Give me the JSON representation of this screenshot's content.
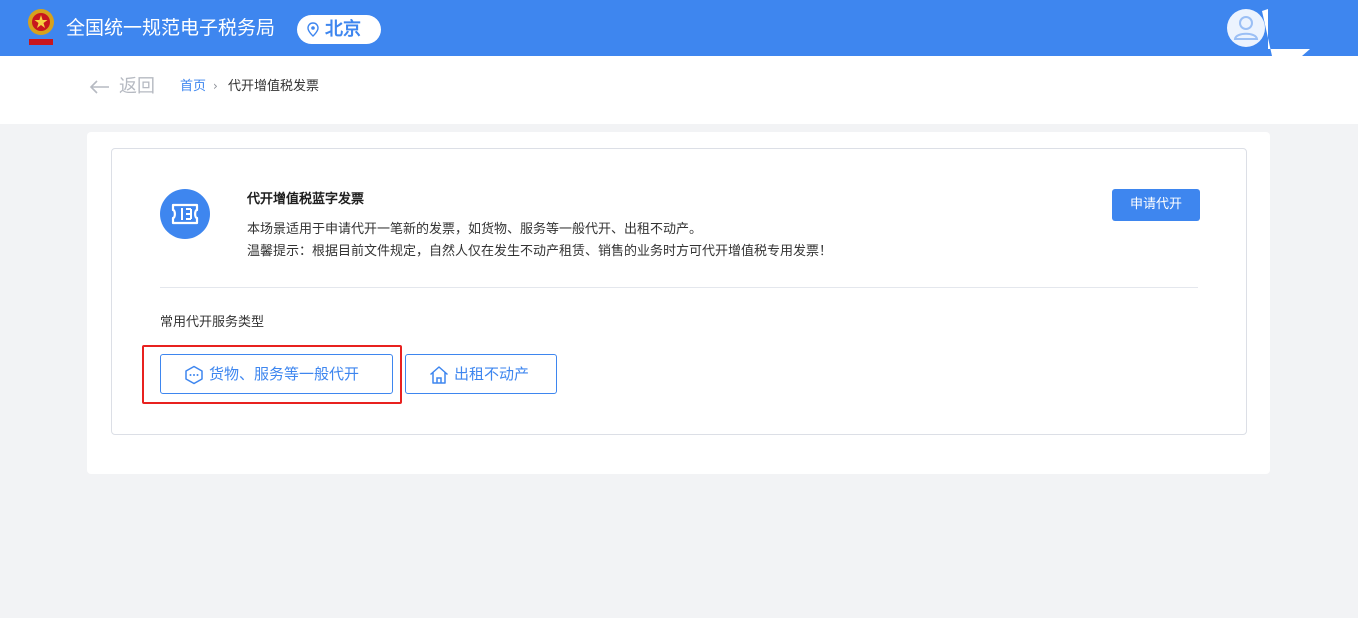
{
  "header": {
    "title": "全国统一规范电子税务局",
    "region": "北京",
    "emblem_icon": "tax-emblem-icon",
    "user_icon": "user-avatar-icon"
  },
  "breadcrumb": {
    "back_label": "返回",
    "home": "首页",
    "separator": "›",
    "current": "代开增值税发票"
  },
  "service": {
    "icon": "ticket-icon",
    "title": "代开增值税蓝字发票",
    "description": "本场景适用于申请代开一笔新的发票，如货物、服务等一般代开、出租不动产。",
    "tip": "温馨提示：根据目前文件规定，自然人仅在发生不动产租赁、销售的业务时方可代开增值税专用发票！",
    "apply_label": "申请代开"
  },
  "types": {
    "section_label": "常用代开服务类型",
    "items": [
      {
        "label": "货物、服务等一般代开",
        "icon": "box-icon",
        "selected": true
      },
      {
        "label": "出租不动产",
        "icon": "house-icon",
        "selected": false
      }
    ]
  },
  "colors": {
    "primary": "#3e86ef",
    "highlight": "#e8211f",
    "background": "#f2f3f5"
  }
}
